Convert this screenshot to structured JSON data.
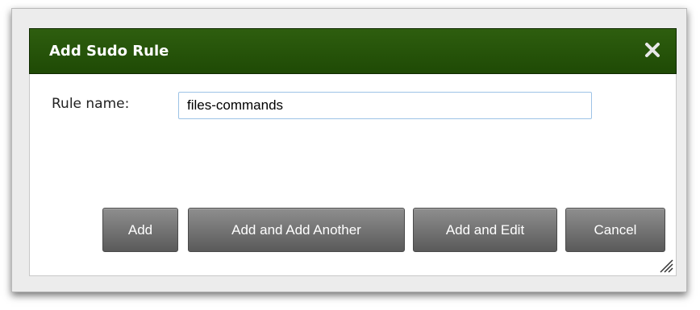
{
  "dialog": {
    "title": "Add Sudo Rule",
    "close_icon": "close-icon",
    "field": {
      "label": "Rule name:",
      "value": "files-commands"
    },
    "buttons": {
      "add": "Add",
      "add_another": "Add and Add Another",
      "add_edit": "Add and Edit",
      "cancel": "Cancel"
    },
    "resize_icon": "resize-grip-icon"
  },
  "colors": {
    "titlebar": "#24500a",
    "button": "#6e6e6e",
    "input_border": "#9dc3e6"
  }
}
